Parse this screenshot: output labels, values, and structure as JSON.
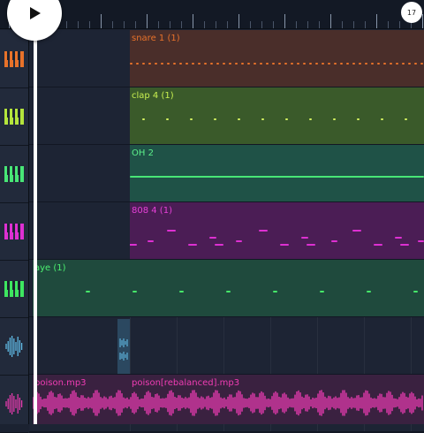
{
  "transport": {
    "play_button": "play-icon",
    "bar_badge": "17"
  },
  "colors": {
    "background": "#1b2231",
    "sidebar": "#222a3b",
    "playhead": "#ffffff",
    "snare": "#e8722a",
    "clap": "#b4e43c",
    "oh": "#48e676",
    "808": "#de30d2",
    "aye": "#3ee660",
    "sample": "#64c4f0",
    "audio": "#f03cb4"
  },
  "tracks": [
    {
      "type": "instrument",
      "icon": "piano-keys-icon",
      "color": "#e8722a"
    },
    {
      "type": "instrument",
      "icon": "piano-keys-icon",
      "color": "#b4e43c"
    },
    {
      "type": "instrument",
      "icon": "piano-keys-icon",
      "color": "#48e676"
    },
    {
      "type": "instrument",
      "icon": "piano-keys-icon",
      "color": "#de30d2"
    },
    {
      "type": "instrument",
      "icon": "piano-keys-icon",
      "color": "#3ee660"
    },
    {
      "type": "audio",
      "icon": "waveform-icon",
      "color": "#64c4f0"
    },
    {
      "type": "audio",
      "icon": "waveform-icon",
      "color": "#f03cb4"
    }
  ],
  "clips": [
    {
      "track": 0,
      "name": "snare 1 (1)"
    },
    {
      "track": 1,
      "name": "clap 4 (1)"
    },
    {
      "track": 2,
      "name": "OH 2"
    },
    {
      "track": 3,
      "name": "808 4 (1)"
    },
    {
      "track": 4,
      "name": "aye (1)"
    },
    {
      "track": 5,
      "name": ""
    },
    {
      "track": 6,
      "name": "poison.mp3"
    },
    {
      "track": 6,
      "name": "poison[rebalanced].mp3"
    }
  ]
}
